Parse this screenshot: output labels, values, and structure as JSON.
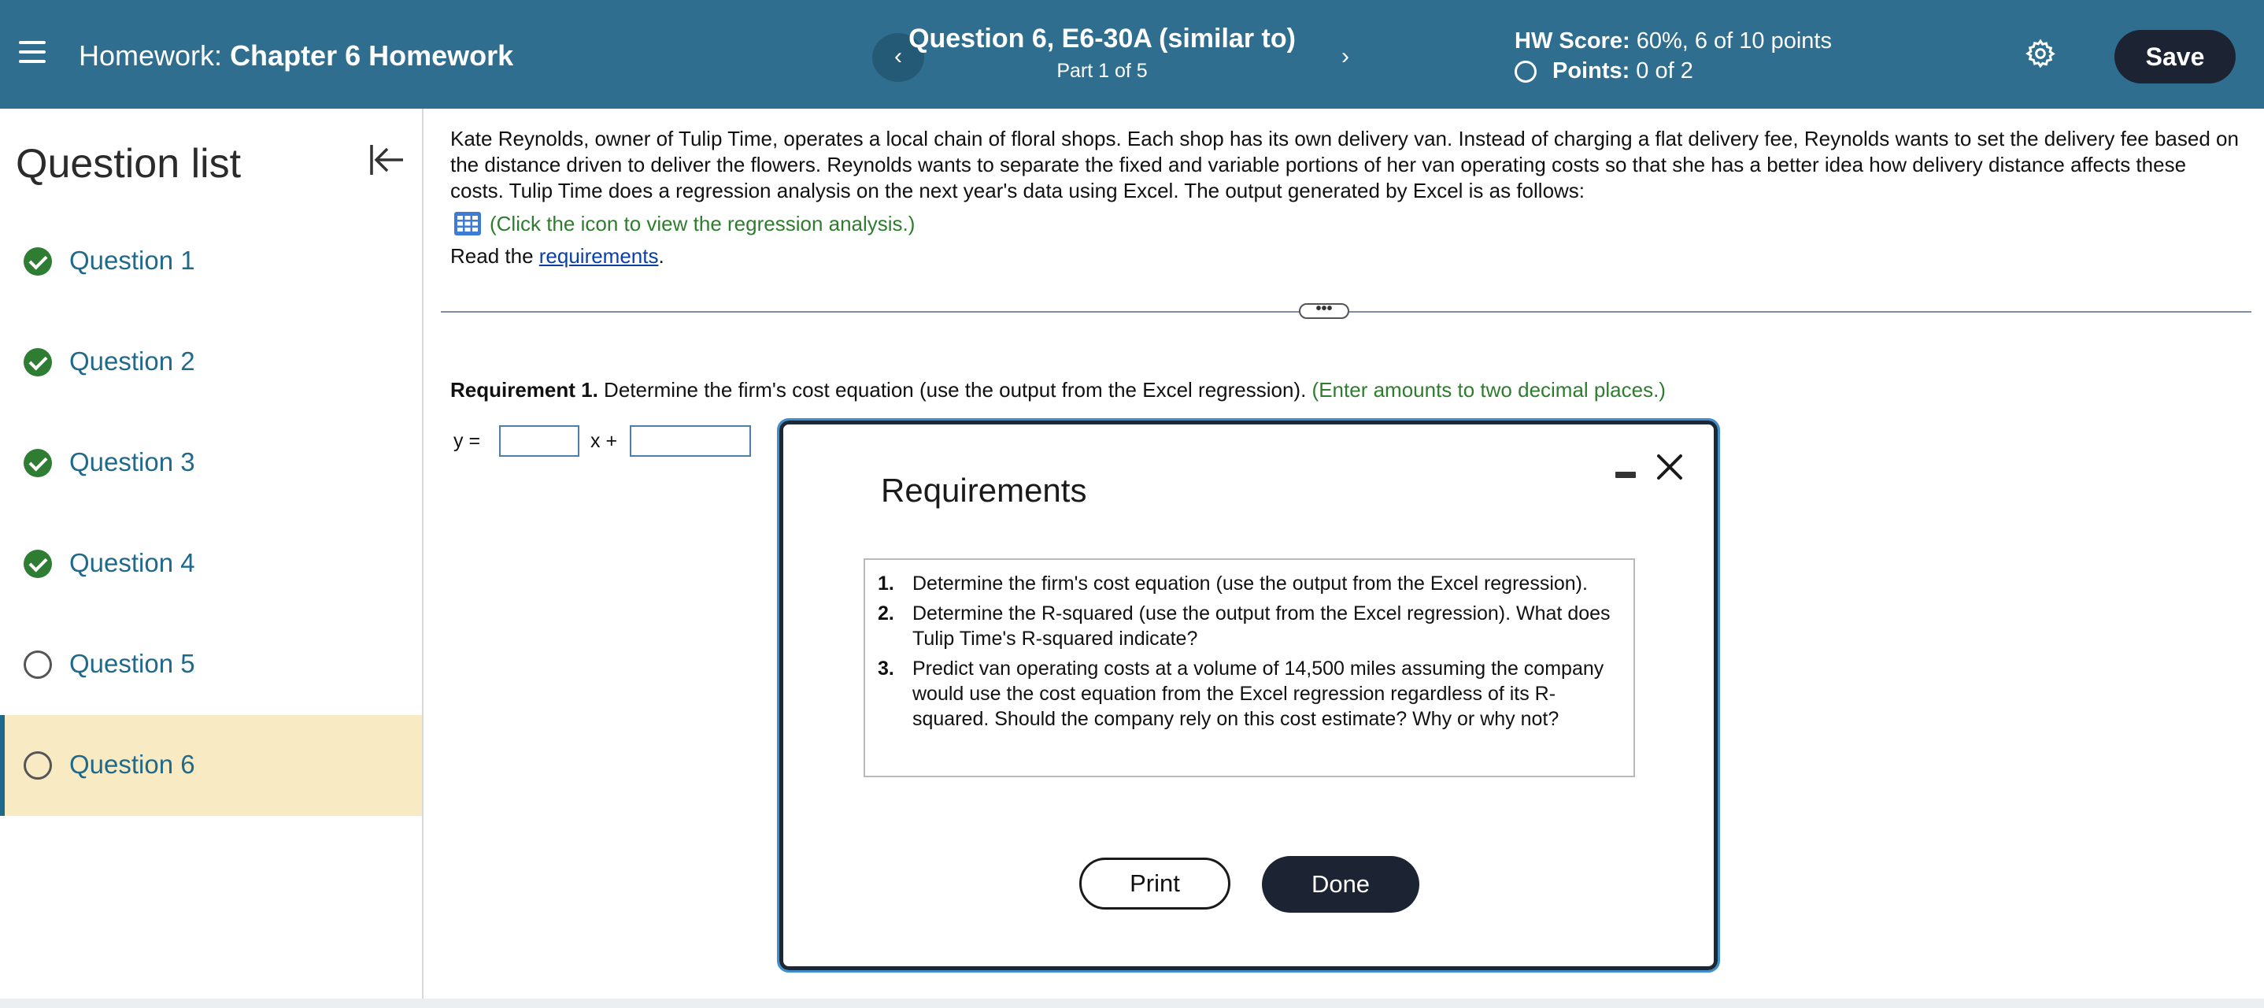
{
  "header": {
    "title_prefix": "Homework:",
    "title_name": "Chapter 6 Homework",
    "question_title": "Question 6, E6-30A (similar to)",
    "part": "Part 1 of 5",
    "hw_score_label": "HW Score:",
    "hw_score_value": "60%, 6 of 10 points",
    "points_label": "Points:",
    "points_value": "0 of 2",
    "save_label": "Save",
    "prev_glyph": "‹",
    "next_glyph": "›"
  },
  "sidebar": {
    "title": "Question list",
    "items": [
      {
        "label": "Question 1",
        "status": "complete"
      },
      {
        "label": "Question 2",
        "status": "complete"
      },
      {
        "label": "Question 3",
        "status": "complete"
      },
      {
        "label": "Question 4",
        "status": "complete"
      },
      {
        "label": "Question 5",
        "status": "incomplete"
      },
      {
        "label": "Question 6",
        "status": "incomplete",
        "active": true
      }
    ]
  },
  "main": {
    "intro": "Kate Reynolds, owner of Tulip Time, operates a local chain of floral shops. Each shop has its own delivery van. Instead of charging a flat delivery fee, Reynolds wants to set the delivery fee based on the distance driven to deliver the flowers. Reynolds wants to separate the fixed and variable portions of her van operating costs so that she has a better idea how delivery distance affects these costs. Tulip Time does a regression analysis on the next year's data using Excel. The output generated by Excel is as follows:",
    "regression_link": "(Click the icon to view the regression analysis.)",
    "read_prefix": "Read the ",
    "requirements_link": "requirements",
    "read_suffix": ".",
    "divider_handle": "•••",
    "req1_label": "Requirement 1.",
    "req1_text": " Determine the firm's cost equation (use the output from the Excel regression). ",
    "req1_hint": "(Enter amounts to two decimal places.)",
    "eq_y": "y =",
    "eq_x": "x +",
    "input1_value": "",
    "input2_value": ""
  },
  "modal": {
    "title": "Requirements",
    "items": [
      {
        "num": "1.",
        "text": "Determine the firm's cost equation (use the output from the Excel regression)."
      },
      {
        "num": "2.",
        "text": "Determine the R-squared (use the output from the Excel regression). What does Tulip Time's R-squared indicate?"
      },
      {
        "num": "3.",
        "text": "Predict van operating costs at a volume of 14,500 miles assuming the company would use the cost equation from the Excel regression regardless of its R-squared. Should the company rely on this cost estimate? Why or why not?"
      }
    ],
    "print_label": "Print",
    "done_label": "Done"
  },
  "colors": {
    "header_bg": "#2f6e8f",
    "button_dark": "#1c2433",
    "link_teal": "#1f6a8c",
    "hint_green": "#2e7d2e",
    "check_green": "#2e7d32",
    "active_item_bg": "#f8eac2"
  },
  "icons": [
    "menu-icon",
    "chevron-left-icon",
    "chevron-right-icon",
    "gear-icon",
    "collapse-icon",
    "check-icon",
    "grid-icon",
    "minimize-icon",
    "close-icon"
  ]
}
